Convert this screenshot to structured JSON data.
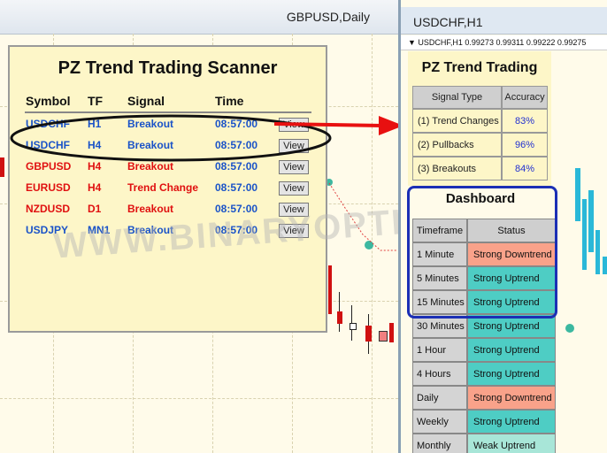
{
  "left_window": {
    "title": "GBPUSD,Daily"
  },
  "scanner": {
    "title": "PZ Trend Trading Scanner",
    "headers": [
      "Symbol",
      "TF",
      "Signal",
      "Time"
    ],
    "rows": [
      {
        "symbol": "USDCHF",
        "tf": "H1",
        "signal": "Breakout",
        "time": "08:57:00",
        "color": "#1a53c8",
        "button": "View"
      },
      {
        "symbol": "USDCHF",
        "tf": "H4",
        "signal": "Breakout",
        "time": "08:57:00",
        "color": "#1a53c8",
        "button": "View"
      },
      {
        "symbol": "GBPUSD",
        "tf": "H4",
        "signal": "Breakout",
        "time": "08:57:00",
        "color": "#e01010",
        "button": "View"
      },
      {
        "symbol": "EURUSD",
        "tf": "H4",
        "signal": "Trend Change",
        "time": "08:57:00",
        "color": "#e01010",
        "button": "View"
      },
      {
        "symbol": "NZDUSD",
        "tf": "D1",
        "signal": "Breakout",
        "time": "08:57:00",
        "color": "#e01010",
        "button": "View"
      },
      {
        "symbol": "USDJPY",
        "tf": "MN1",
        "signal": "Breakout",
        "time": "08:57:00",
        "color": "#1a53c8",
        "button": "View"
      }
    ]
  },
  "right_window": {
    "title": "USDCHF,H1",
    "sub_label": "▼ USDCHF,H1  0.99273 0.99311 0.99222 0.99275"
  },
  "trend_panel": {
    "title": "PZ Trend Trading",
    "headers": [
      "Signal Type",
      "Accuracy"
    ],
    "rows": [
      {
        "type": "(1) Trend Changes",
        "accuracy": "83%"
      },
      {
        "type": "(2) Pullbacks",
        "accuracy": "96%"
      },
      {
        "type": "(3) Breakouts",
        "accuracy": "84%"
      }
    ]
  },
  "dashboard": {
    "title": "Dashboard",
    "headers": [
      "Timeframe",
      "Status"
    ],
    "rows": [
      {
        "tf": "1 Minute",
        "status": "Strong Downtrend",
        "kind": "down"
      },
      {
        "tf": "5 Minutes",
        "status": "Strong Uptrend",
        "kind": "up"
      },
      {
        "tf": "15 Minutes",
        "status": "Strong Uptrend",
        "kind": "up"
      },
      {
        "tf": "30 Minutes",
        "status": "Strong Uptrend",
        "kind": "up"
      },
      {
        "tf": "1 Hour",
        "status": "Strong Uptrend",
        "kind": "up"
      },
      {
        "tf": "4 Hours",
        "status": "Strong Uptrend",
        "kind": "up"
      },
      {
        "tf": "Daily",
        "status": "Strong Downtrend",
        "kind": "down"
      },
      {
        "tf": "Weekly",
        "status": "Strong Uptrend",
        "kind": "up"
      },
      {
        "tf": "Monthly",
        "status": "Weak Uptrend",
        "kind": "weak"
      }
    ]
  },
  "watermark": "WWW.BINARYOPTIONSIGNALS.COM",
  "colors": {
    "highlight_arrow": "#e81010",
    "dashboard_border": "#1b2fb5",
    "uptrend": "#4ecdc4",
    "downtrend": "#f9a28a"
  }
}
